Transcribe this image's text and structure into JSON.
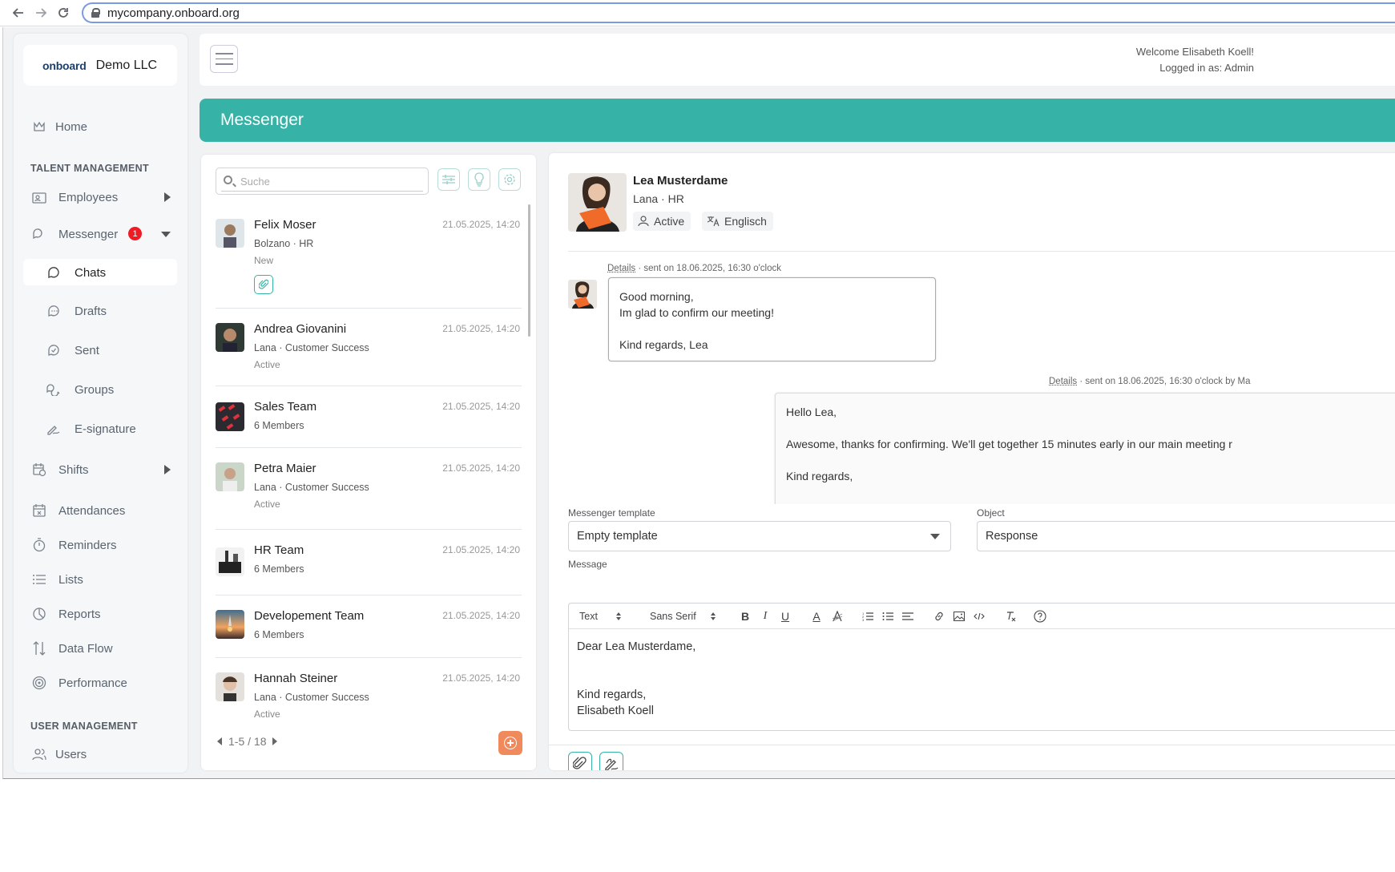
{
  "browser": {
    "url": "mycompany.onboard.org"
  },
  "sidebar": {
    "logo": "onboard",
    "company": "Demo LLC",
    "home": "Home",
    "section_talent": "TALENT MANAGEMENT",
    "employees": "Employees",
    "messenger": "Messenger",
    "messenger_badge": "1",
    "chats": "Chats",
    "drafts": "Drafts",
    "sent": "Sent",
    "groups": "Groups",
    "esignature": "E-signature",
    "shifts": "Shifts",
    "attendances": "Attendances",
    "reminders": "Reminders",
    "lists": "Lists",
    "reports": "Reports",
    "dataflow": "Data Flow",
    "performance": "Performance",
    "section_user": "USER MANAGEMENT",
    "users": "Users"
  },
  "header": {
    "welcome": "Welcome Elisabeth Koell!",
    "logged_in": "Logged in as: Admin"
  },
  "page_title": "Messenger",
  "chat_list": {
    "search_placeholder": "Suche",
    "items": [
      {
        "name": "Felix Moser",
        "time": "21.05.2025, 14:20",
        "sub": "Bolzano · HR",
        "status": "New"
      },
      {
        "name": "Andrea Giovanini",
        "time": "21.05.2025, 14:20",
        "sub": "Lana · Customer Success",
        "status": "Active"
      },
      {
        "name": "Sales Team",
        "time": "21.05.2025, 14:20",
        "sub": "6 Members",
        "status": ""
      },
      {
        "name": "Petra Maier",
        "time": "21.05.2025, 14:20",
        "sub": "Lana · Customer Success",
        "status": "Active"
      },
      {
        "name": "HR Team",
        "time": "21.05.2025, 14:20",
        "sub": "6 Members",
        "status": ""
      },
      {
        "name": "Developement Team",
        "time": "21.05.2025, 14:20",
        "sub": "6 Members",
        "status": ""
      },
      {
        "name": "Hannah Steiner",
        "time": "21.05.2025, 14:20",
        "sub": "Lana · Customer Success",
        "status": "Active"
      }
    ],
    "pager": "1-5 / 18"
  },
  "conversation": {
    "contact_name": "Lea Musterdame",
    "contact_sub": "Lana · HR",
    "chip_status": "Active",
    "chip_language": "Englisch",
    "msg1_details": "Details",
    "msg1_meta": " · sent on 18.06.2025, 16:30 o'clock",
    "msg1_line1": "Good morning,",
    "msg1_line2": "Im glad to confirm our meeting!",
    "msg1_line3": "Kind regards, Lea",
    "msg2_details": "Details",
    "msg2_meta": " · sent on 18.06.2025, 16:30 o'clock by Ma",
    "msg2_line1": "Hello Lea,",
    "msg2_line2": "Awesome, thanks for confirming. We'll get together 15 minutes early in our main meeting r",
    "msg2_line3": "Kind regards,",
    "template_label": "Messenger template",
    "template_value": "Empty template",
    "object_label": "Object",
    "object_value": "Response",
    "message_label": "Message",
    "toolbar_text": "Text",
    "toolbar_font": "Sans Serif",
    "body_line1": "Dear Lea Musterdame,",
    "body_line2": "Kind regards,",
    "body_line3": "Elisabeth Koell"
  }
}
